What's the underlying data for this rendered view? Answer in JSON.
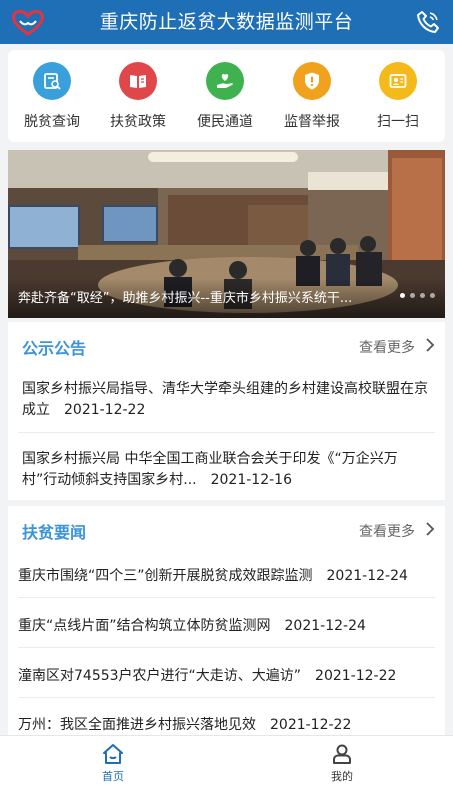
{
  "header": {
    "title": "重庆防止返贫大数据监测平台",
    "logo_icon": "heart-hands-logo",
    "phone_icon": "phone-icon"
  },
  "quick_actions": [
    {
      "label": "脱贫查询",
      "icon": "query-icon",
      "color": "#3aa0dc"
    },
    {
      "label": "扶贫政策",
      "icon": "policy-book-icon",
      "color": "#e0474b"
    },
    {
      "label": "便民通道",
      "icon": "helping-hand-icon",
      "color": "#3fb24f"
    },
    {
      "label": "监督举报",
      "icon": "shield-alert-icon",
      "color": "#f0a21c"
    },
    {
      "label": "扫一扫",
      "icon": "scan-icon",
      "color": "#f4ba1c"
    }
  ],
  "banner": {
    "caption": "奔赴齐备“取经”，助推乡村振兴--重庆市乡村振兴系统干...",
    "slide_count": 4,
    "active_slide": 1
  },
  "notice": {
    "title": "公示公告",
    "more": "查看更多",
    "items": [
      {
        "text": "国家乡村振兴局指导、清华大学牵头组建的乡村建设高校联盟在京成立",
        "date": "2021-12-22"
      },
      {
        "text": "国家乡村振兴局 中华全国工商业联合会关于印发《“万企兴万村”行动倾斜支持国家乡村...",
        "date": "2021-12-16"
      }
    ]
  },
  "news": {
    "title": "扶贫要闻",
    "more": "查看更多",
    "items": [
      {
        "text": "重庆市围绕“四个三”创新开展脱贫成效跟踪监测",
        "date": "2021-12-24"
      },
      {
        "text": "重庆“点线片面”结合构筑立体防贫监测网",
        "date": "2021-12-24"
      },
      {
        "text": "潼南区对74553户农户进行“大走访、大遍访”",
        "date": "2021-12-22"
      },
      {
        "text": "万州：我区全面推进乡村振兴落地见效",
        "date": "2021-12-22"
      }
    ]
  },
  "tabbar": [
    {
      "label": "首页",
      "icon": "home-icon",
      "active": true
    },
    {
      "label": "我的",
      "icon": "user-icon",
      "active": false
    }
  ],
  "colors": {
    "primary": "#1e6fb6",
    "accent": "#3b94d9"
  }
}
